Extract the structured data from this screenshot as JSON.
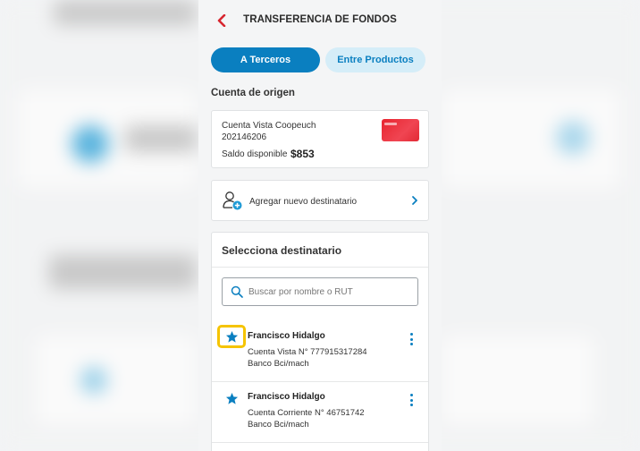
{
  "header": {
    "title": "TRANSFERENCIA DE FONDOS"
  },
  "tabs": [
    {
      "label": "A Terceros",
      "active": true
    },
    {
      "label": "Entre Productos",
      "active": false
    }
  ],
  "origin": {
    "section_title": "Cuenta de origen",
    "account_name": "Cuenta Vista Coopeuch",
    "account_number": "202146206",
    "balance_label": "Saldo disponible",
    "balance": "$853"
  },
  "add_recipient": {
    "label": "Agregar nuevo destinatario"
  },
  "recipients": {
    "title": "Selecciona destinatario",
    "search_placeholder": "Buscar por nombre o RUT",
    "items": [
      {
        "name": "Francisco Hidalgo",
        "account": "Cuenta Vista N° 777915317284",
        "bank": "Banco Bci/mach",
        "favorite": true
      },
      {
        "name": "Francisco Hidalgo",
        "account": "Cuenta Corriente N° 46751742",
        "bank": "Banco Bci/mach",
        "favorite": true
      }
    ]
  },
  "colors": {
    "accent": "#0a7fc0",
    "back_arrow": "#d7262f",
    "highlight": "#f5c400",
    "card_red": "#e8242f"
  }
}
